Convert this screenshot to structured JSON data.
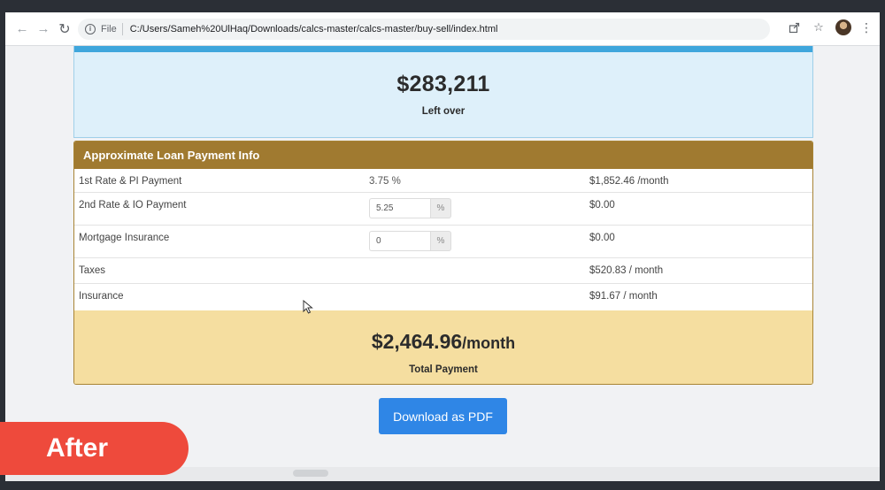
{
  "browser": {
    "file_label": "File",
    "url": "C:/Users/Sameh%20UlHaq/Downloads/calcs-master/calcs-master/buy-sell/index.html"
  },
  "leftover": {
    "amount": "$283,211",
    "label": "Left over",
    "accent_color": "#3fa6dc"
  },
  "loan": {
    "header": "Approximate Loan Payment Info",
    "header_color": "#a07a30",
    "rows": [
      {
        "label": "1st Rate & PI Payment",
        "rate": "3.75 %",
        "amount": "$1,852.46 /month"
      },
      {
        "label": "2nd Rate & IO Payment",
        "rate_value": "5.25",
        "rate_unit": "%",
        "amount": "$0.00"
      },
      {
        "label": "Mortgage Insurance",
        "rate_value": "0",
        "rate_unit": "%",
        "amount": "$0.00"
      },
      {
        "label": "Taxes",
        "amount": "$520.83 / month"
      },
      {
        "label": "Insurance",
        "amount": "$91.67 / month"
      }
    ]
  },
  "total": {
    "amount": "$2,464.96",
    "period": "/month",
    "label": "Total Payment"
  },
  "download_button": "Download as PDF",
  "overlay_badge": "After"
}
